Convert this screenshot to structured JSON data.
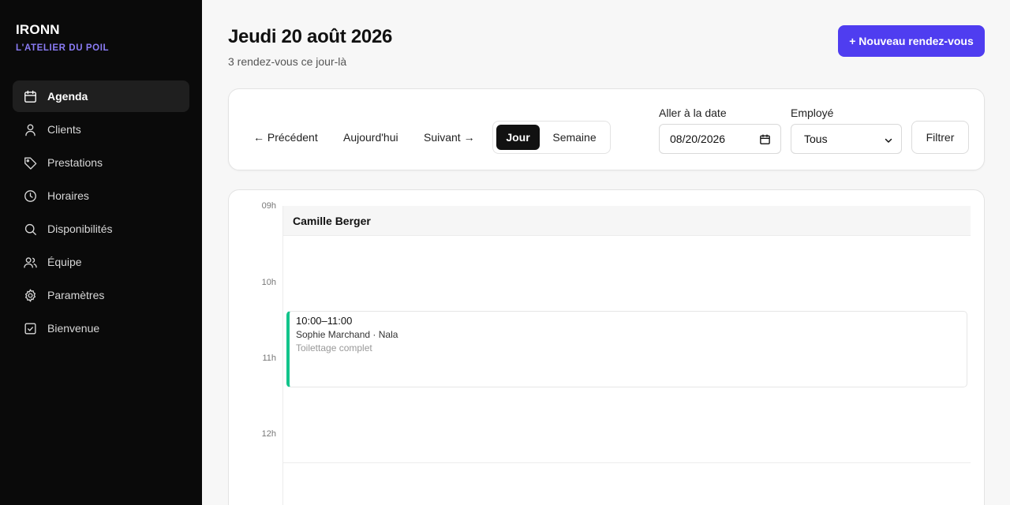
{
  "brand": {
    "name": "IRONN",
    "subtitle": "L'ATELIER DU POIL"
  },
  "sidebar": {
    "items": [
      {
        "label": "Agenda",
        "icon": "calendar-icon",
        "active": true
      },
      {
        "label": "Clients",
        "icon": "user-icon"
      },
      {
        "label": "Prestations",
        "icon": "tag-icon"
      },
      {
        "label": "Horaires",
        "icon": "clock-icon"
      },
      {
        "label": "Disponibilités",
        "icon": "search-icon"
      },
      {
        "label": "Équipe",
        "icon": "users-icon"
      },
      {
        "label": "Paramètres",
        "icon": "gear-icon"
      },
      {
        "label": "Bienvenue",
        "icon": "check-square-icon"
      }
    ]
  },
  "header": {
    "title": "Jeudi 20 août 2026",
    "subtitle": "3 rendez-vous ce jour-là",
    "new_button": "+ Nouveau rendez-vous"
  },
  "toolbar": {
    "prev": "← Précédent",
    "today": "Aujourd'hui",
    "next": "Suivant →",
    "view_day": "Jour",
    "view_week": "Semaine",
    "active_view": "Jour",
    "date_label": "Aller à la date",
    "date_value": "08/20/2026",
    "employee_label": "Employé",
    "employee_value": "Tous",
    "filter_button": "Filtrer"
  },
  "calendar": {
    "hours": [
      "09h",
      "10h",
      "11h",
      "12h"
    ],
    "employee": "Camille Berger",
    "events": [
      {
        "time": "10:00–11:00",
        "client": "Sophie Marchand · Nala",
        "service": "Toilettage complet",
        "color": "#12c48b"
      }
    ]
  },
  "colors": {
    "accent": "#4f3df0",
    "brand_sub": "#8b7cf6",
    "event": "#12c48b",
    "sidebar_bg": "#0a0a0a"
  }
}
